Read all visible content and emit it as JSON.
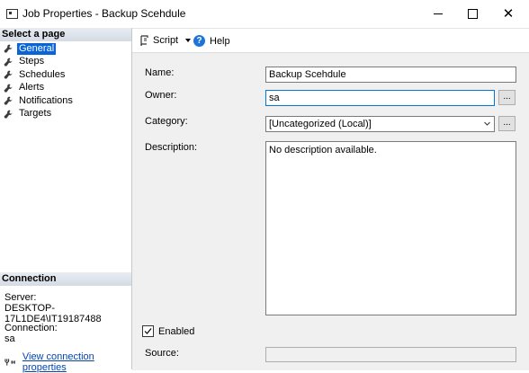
{
  "window": {
    "title": "Job Properties - Backup Scehdule"
  },
  "left_pane": {
    "select_header": "Select a page",
    "pages": [
      {
        "label": "General",
        "active": true
      },
      {
        "label": "Steps"
      },
      {
        "label": "Schedules"
      },
      {
        "label": "Alerts"
      },
      {
        "label": "Notifications"
      },
      {
        "label": "Targets"
      }
    ],
    "connection_header": "Connection",
    "server_label": "Server:",
    "server_value": "DESKTOP-17L1DE4\\IT19187488",
    "connection_label": "Connection:",
    "connection_value": "sa",
    "connection_link": "View connection properties"
  },
  "toolbar": {
    "script_label": "Script",
    "help_label": "Help"
  },
  "form": {
    "name_label": "Name:",
    "name_value": "Backup Scehdule",
    "owner_label": "Owner:",
    "owner_value": "sa",
    "owner_button": "...",
    "category_label": "Category:",
    "category_value": "[Uncategorized (Local)]",
    "category_button": "...",
    "description_label": "Description:",
    "description_value": "No description available.",
    "enabled_label": "Enabled",
    "enabled_checked": true,
    "source_label": "Source:",
    "source_value": ""
  }
}
